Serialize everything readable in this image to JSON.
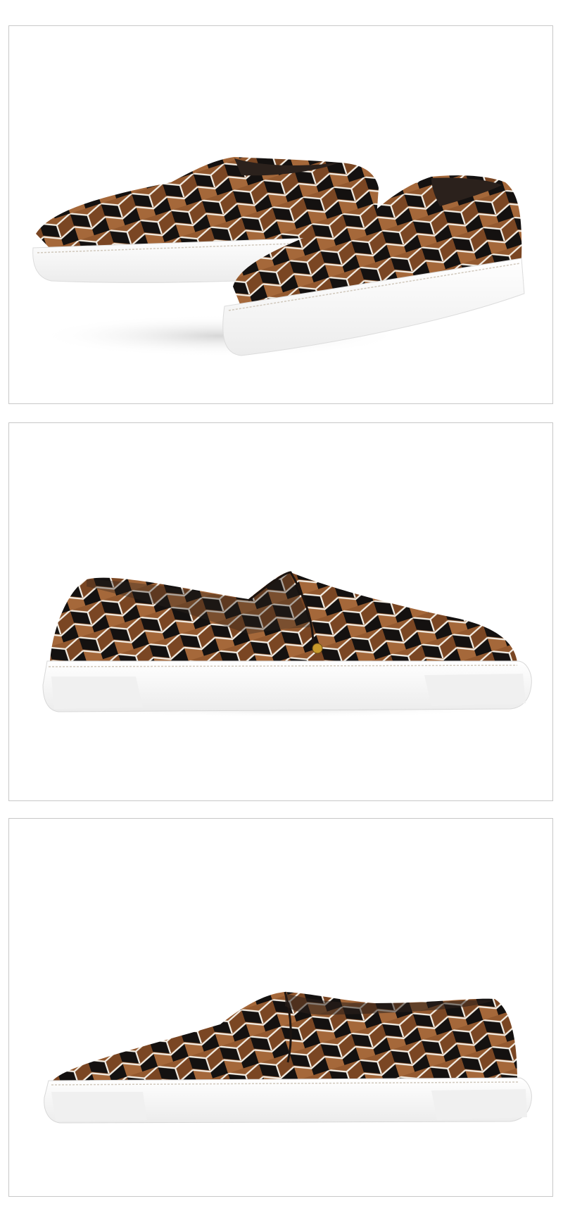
{
  "gallery": {
    "panels": [
      {
        "view": "pair-three-quarter-front"
      },
      {
        "view": "single-side-profile-heel-left"
      },
      {
        "view": "single-side-profile-heel-right"
      }
    ]
  },
  "colors": {
    "background": "#ffffff",
    "frame_border": "#c8c8c8",
    "pattern_brown": "#93592f",
    "pattern_black": "#141110",
    "pattern_white_stripe": "#f4efe6",
    "sole_white": "#fafafa",
    "sole_shadow": "#e3e3e3",
    "lining_dark": "#2b211c",
    "eyelet_gold": "#c89a2c"
  }
}
